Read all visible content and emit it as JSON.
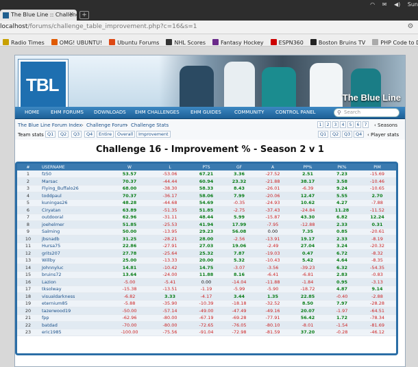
{
  "browser": {
    "tab_title": "The Blue Line :: Challenge",
    "tab_close": "×",
    "new_tab": "+",
    "system_user": "Sun",
    "url_host": "localhost",
    "url_rest": "/forums/challenge_table_improvement.php?c=16&s=1",
    "bookmarks": [
      {
        "label": "Radio Times",
        "color": "#c8a000"
      },
      {
        "label": "OMG! UBUNTU!",
        "color": "#e05a00"
      },
      {
        "label": "Ubuntu Forums",
        "color": "#dd4814"
      },
      {
        "label": "NHL Scores",
        "color": "#333333"
      },
      {
        "label": "Fantasy Hockey",
        "color": "#6a2a8a"
      },
      {
        "label": "ESPN360",
        "color": "#cc0000"
      },
      {
        "label": "Boston Bruins TV",
        "color": "#222222"
      },
      {
        "label": "PHP Code to D...",
        "color": "#aaaaaa"
      }
    ]
  },
  "site": {
    "logo_text": "TBL",
    "name": "The Blue Line",
    "nav": [
      "HOME",
      "EHM FORUMS",
      "DOWNLOADS",
      "EHM CHALLENGES",
      "EHM GUIDES",
      "COMMUNITY",
      "CONTROL PANEL"
    ],
    "search_placeholder": "Search"
  },
  "breadcrumb": {
    "items": [
      "The Blue Line Forum Index",
      "Challenge Forum",
      "Challenge Stats"
    ],
    "sep": "›",
    "seasons_pages": [
      "1",
      "2",
      "3",
      "4",
      "5",
      "6",
      "7"
    ],
    "seasons_label": "‹ Seasons",
    "team_stats_label": "Team stats ›",
    "team_links": [
      "Q1",
      "Q2",
      "Q3",
      "Q4",
      "Entire",
      "Overall",
      "Improvement"
    ],
    "player_links": [
      "Q1",
      "Q2",
      "Q3",
      "Q4"
    ],
    "player_stats_label": "‹ Player stats"
  },
  "title": "Challenge 16 - Improvement % - Season 2 v 1",
  "table": {
    "columns": [
      "#",
      "USERNAME",
      "W",
      "L",
      "PTS",
      "GF",
      "A",
      "PP%",
      "PK%",
      "PIM"
    ],
    "rows": [
      [
        "1",
        "fz50",
        "53.57",
        "-53.06",
        "67.21",
        "3.36",
        "-27.52",
        "2.51",
        "7.23",
        "-15.69"
      ],
      [
        "2",
        "Marsac",
        "70.37",
        "-44.44",
        "60.94",
        "23.32",
        "-21.88",
        "38.17",
        "3.58",
        "-10.46"
      ],
      [
        "3",
        "Flying_Buffalo26",
        "68.00",
        "-38.30",
        "58.33",
        "8.43",
        "-26.01",
        "-6.39",
        "9.24",
        "-10.65"
      ],
      [
        "4",
        "toddpaul",
        "70.37",
        "-36.17",
        "58.06",
        "7.99",
        "-20.06",
        "12.47",
        "5.55",
        "2.70"
      ],
      [
        "5",
        "kuningas26",
        "48.28",
        "-44.68",
        "54.69",
        "-0.35",
        "-24.93",
        "10.62",
        "4.27",
        "-7.88"
      ],
      [
        "6",
        "Ciryatan",
        "63.89",
        "-51.35",
        "51.85",
        "-2.75",
        "-37.43",
        "-24.84",
        "11.28",
        "-11.52"
      ],
      [
        "7",
        "outdooral",
        "62.96",
        "-31.11",
        "48.44",
        "5.99",
        "-15.87",
        "43.30",
        "6.82",
        "12.24"
      ],
      [
        "8",
        "joehelmer",
        "51.85",
        "-25.53",
        "41.94",
        "17.99",
        "-7.95",
        "-12.88",
        "2.33",
        "0.31"
      ],
      [
        "9",
        "Salming",
        "50.00",
        "-13.95",
        "29.23",
        "56.08",
        "0.00",
        "7.35",
        "0.85",
        "-20.61"
      ],
      [
        "10",
        "jbsnadb",
        "31.25",
        "-28.21",
        "28.00",
        "-2.56",
        "-13.91",
        "19.17",
        "2.33",
        "-8.19"
      ],
      [
        "11",
        "Hursa75",
        "22.86",
        "-27.91",
        "27.03",
        "19.06",
        "-2.49",
        "27.04",
        "3.24",
        "-20.32"
      ],
      [
        "12",
        "grits207",
        "27.78",
        "-25.64",
        "25.32",
        "7.87",
        "-19.03",
        "0.47",
        "6.72",
        "-8.32"
      ],
      [
        "13",
        "Willby",
        "25.00",
        "-13.33",
        "20.00",
        "5.32",
        "-10.43",
        "5.42",
        "4.64",
        "-8.35"
      ],
      [
        "14",
        "Johnnyluc",
        "14.81",
        "-10.42",
        "14.75",
        "-3.07",
        "-3.56",
        "-39.23",
        "6.32",
        "-54.35"
      ],
      [
        "15",
        "bruins72",
        "13.64",
        "-24.00",
        "11.88",
        "8.16",
        "-6.41",
        "-6.81",
        "2.83",
        "-0.83"
      ],
      [
        "16",
        "Lazion",
        "-5.00",
        "-5.41",
        "0.00",
        "-14.04",
        "-11.88",
        "-1.84",
        "0.95",
        "-3.13"
      ],
      [
        "17",
        "tksolway",
        "-15.38",
        "-13.51",
        "-1.19",
        "-5.99",
        "-5.90",
        "-18.72",
        "4.87",
        "9.14"
      ],
      [
        "18",
        "visualdarkness",
        "-6.82",
        "3.33",
        "-4.17",
        "3.44",
        "1.35",
        "22.85",
        "-0.40",
        "-2.88"
      ],
      [
        "19",
        "eternium85",
        "-5.88",
        "-35.90",
        "-10.39",
        "-18.18",
        "-32.52",
        "8.50",
        "7.97",
        "-28.28"
      ],
      [
        "20",
        "tazerwood19",
        "-50.00",
        "-57.14",
        "-49.00",
        "-47.49",
        "-49.16",
        "20.07",
        "-1.97",
        "-64.51"
      ],
      [
        "21",
        "fpp",
        "-62.96",
        "-80.00",
        "-67.19",
        "-69.28",
        "-77.91",
        "56.42",
        "1.72",
        "-78.34"
      ],
      [
        "22",
        "batdad",
        "-70.00",
        "-80.00",
        "-72.65",
        "-76.05",
        "-80.10",
        "-8.01",
        "-1.54",
        "-81.69"
      ],
      [
        "23",
        "eric1985",
        "-100.00",
        "-75.56",
        "-91.04",
        "-72.98",
        "-81.59",
        "37.20",
        "-0.28",
        "-46.12"
      ]
    ]
  },
  "colors": {
    "positive": "#0a7d18",
    "negative": "#cc2222",
    "table_header": "#3a7ab0",
    "nav_bar": "#1c5f96"
  }
}
